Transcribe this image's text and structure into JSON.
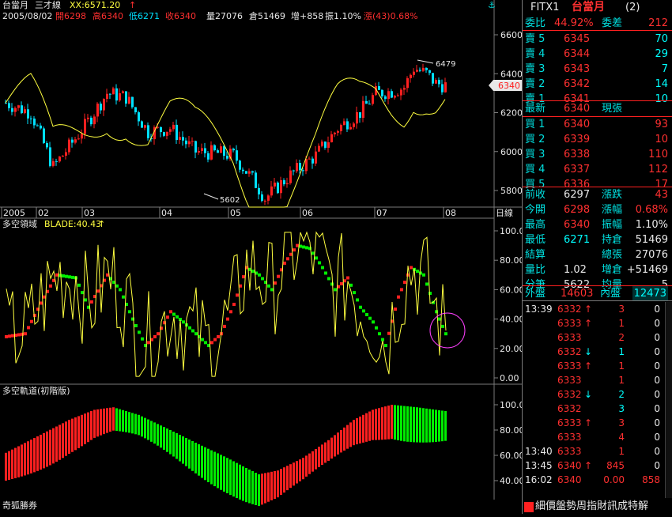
{
  "top_bar": {
    "symbol": "台當月",
    "indicator": "三才線",
    "xx": "XX:6571.20",
    "date": "2005/08/02",
    "open": "開6298",
    "high": "高6340",
    "low": "低6271",
    "close": "收6340",
    "volume": "量27076",
    "oi": "倉51469",
    "oi_change": "增+858",
    "amplitude": "振1.10%",
    "change": "漲(43)0.68%",
    "anchor_icon": "anchor-icon"
  },
  "main_chart": {
    "y_ticks": [
      "6600",
      "6400",
      "6200",
      "6000",
      "5800"
    ],
    "price_tag": "6340",
    "high_label": "6479",
    "low_label": "5602",
    "x_labels": [
      "2005",
      "02",
      "03",
      "04",
      "05",
      "06",
      "07",
      "08"
    ],
    "period_label": "日線"
  },
  "blade_panel": {
    "title": "多空領域",
    "blade": "BLADE:40.43",
    "y_ticks": [
      "100.00",
      "80.00",
      "60.00",
      "40.00",
      "20.00",
      "0.00"
    ]
  },
  "track_panel": {
    "title": "多空軌道(初階版)",
    "y_ticks": [
      "100.00",
      "80.00",
      "60.00",
      "40.00"
    ]
  },
  "brand": "奇狐勝券",
  "side": {
    "header": {
      "code": "FITX1",
      "name": "台當月",
      "window": "(2)"
    },
    "ratio": {
      "label": "委比",
      "value": "44.92%",
      "diff_label": "委差",
      "diff": "212"
    },
    "asks": [
      {
        "label": "賣 5",
        "price": "6345",
        "qty": "70"
      },
      {
        "label": "賣 4",
        "price": "6344",
        "qty": "29"
      },
      {
        "label": "賣 3",
        "price": "6343",
        "qty": "7"
      },
      {
        "label": "賣 2",
        "price": "6342",
        "qty": "14"
      },
      {
        "label": "賣 1",
        "price": "6341",
        "qty": "10"
      }
    ],
    "last": {
      "label": "最新",
      "price": "6340",
      "tag": "現張"
    },
    "bids": [
      {
        "label": "買 1",
        "price": "6340",
        "qty": "93"
      },
      {
        "label": "買 2",
        "price": "6339",
        "qty": "10"
      },
      {
        "label": "買 3",
        "price": "6338",
        "qty": "110"
      },
      {
        "label": "買 4",
        "price": "6337",
        "qty": "112"
      },
      {
        "label": "買 5",
        "price": "6336",
        "qty": "17"
      }
    ],
    "stats": [
      {
        "l1": "前收",
        "v1": "6297",
        "c1": "wht",
        "l2": "漲跌",
        "v2": "43",
        "c2": "red"
      },
      {
        "l1": "今開",
        "v1": "6298",
        "c1": "red",
        "l2": "漲幅",
        "v2": "0.68%",
        "c2": "red"
      },
      {
        "l1": "最高",
        "v1": "6340",
        "c1": "red",
        "l2": "振幅",
        "v2": "1.10%",
        "c2": "wht"
      },
      {
        "l1": "最低",
        "v1": "6271",
        "c1": "cyn",
        "l2": "持倉",
        "v2": "51469",
        "c2": "wht"
      },
      {
        "l1": "結算",
        "v1": "",
        "c1": "wht",
        "l2": "總張",
        "v2": "27076",
        "c2": "wht"
      },
      {
        "l1": "量比",
        "v1": "1.02",
        "c1": "wht",
        "l2": "增倉",
        "v2": "+51469",
        "c2": "wht"
      },
      {
        "l1": "分筆",
        "v1": "5622",
        "c1": "wht",
        "l2": "均量",
        "v2": "5",
        "c2": "wht"
      }
    ],
    "outer": {
      "label": "外盤",
      "value": "14603",
      "inner_label": "內盤",
      "inner": "12473"
    },
    "ticks": [
      {
        "time": "13:39",
        "price": "6332",
        "dir": "up",
        "qty": "3",
        "oi": "0"
      },
      {
        "time": "",
        "price": "6333",
        "dir": "up",
        "qty": "1",
        "oi": "0"
      },
      {
        "time": "",
        "price": "6333",
        "dir": "",
        "qty": "2",
        "oi": "0"
      },
      {
        "time": "",
        "price": "6332",
        "dir": "down",
        "qty": "1",
        "oi": "0"
      },
      {
        "time": "",
        "price": "6333",
        "dir": "up",
        "qty": "1",
        "oi": "0"
      },
      {
        "time": "",
        "price": "6333",
        "dir": "",
        "qty": "1",
        "oi": "0"
      },
      {
        "time": "",
        "price": "6332",
        "dir": "down",
        "qty": "2",
        "oi": "0"
      },
      {
        "time": "",
        "price": "6332",
        "dir": "",
        "qty": "3",
        "oi": "0"
      },
      {
        "time": "",
        "price": "6333",
        "dir": "up",
        "qty": "3",
        "oi": "0"
      },
      {
        "time": "",
        "price": "6333",
        "dir": "",
        "qty": "4",
        "oi": "0"
      },
      {
        "time": "13:40",
        "price": "6333",
        "dir": "",
        "qty": "1",
        "oi": "0"
      },
      {
        "time": "13:45",
        "price": "6340",
        "dir": "up",
        "qty": "845",
        "oi": "0"
      },
      {
        "time": "16:02",
        "price": "6340",
        "dir": "",
        "qty": "0.00",
        "oi": "858"
      }
    ],
    "footer": "細價盤勢周指財訊成特解"
  },
  "colors": {
    "up": "#ff2020",
    "down": "#00e0ff",
    "bull": "#00ee00",
    "ma": "#ffff40",
    "axis": "#808080"
  }
}
